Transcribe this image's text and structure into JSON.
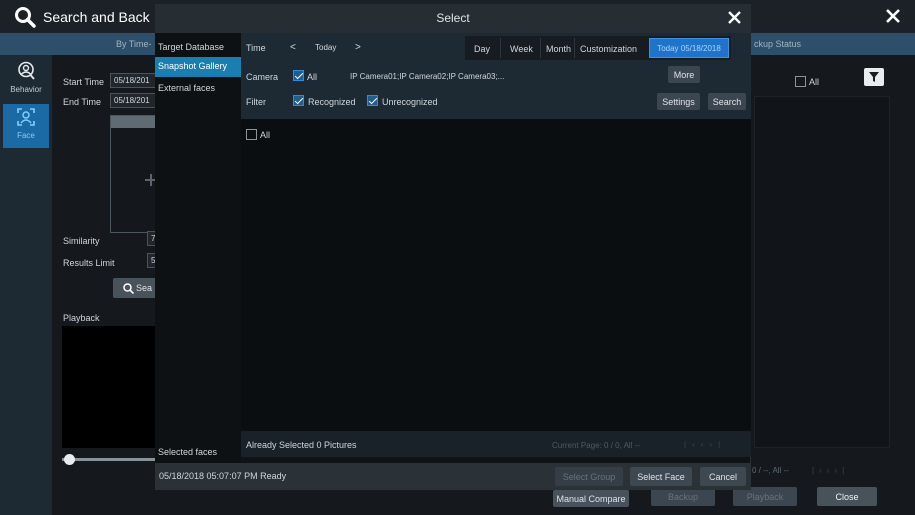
{
  "main": {
    "title": "Search and Back",
    "tab_partial": "By Time-",
    "backup_status": "ckup Status",
    "all_label": "All",
    "start_time_label": "Start Time",
    "start_time_value": "05/18/201",
    "end_time_label": "End Time",
    "end_time_value": "05/18/201",
    "similarity_label": "Similarity",
    "similarity_value": "7",
    "results_limit_label": "Results Limit",
    "results_limit_value": "5",
    "search_partial": "Sea",
    "playback_label": "Playback",
    "pager_partial": "0 / --, All --",
    "manual_compare": "Manual Compare",
    "backup": "Backup",
    "playback_btn": "Playback",
    "close": "Close"
  },
  "sidebar": {
    "behavior": "Behavior",
    "face": "Face"
  },
  "dialog": {
    "title": "Select",
    "nav": [
      "Target Database",
      "Snapshot Gallery",
      "External faces"
    ],
    "selected_faces": "Selected faces",
    "time_label": "Time",
    "today": "Today",
    "range_tabs": [
      "Day",
      "Week",
      "Month",
      "Customization"
    ],
    "date_badge": "Today 05/18/2018",
    "camera_label": "Camera",
    "camera_all": "All",
    "camera_list": "IP Camera01;IP Camera02;IP Camera03;...",
    "more": "More",
    "filter_label": "Filter",
    "recognized": "Recognized",
    "unrecognized": "Unrecognized",
    "settings": "Settings",
    "search": "Search",
    "grid_all": "All",
    "already_selected": "Already Selected 0 Pictures",
    "current_page": "Current Page: 0 / 0, All --",
    "status": "05/18/2018 05:07:07 PM Ready",
    "select_group": "Select Group",
    "select_face": "Select Face",
    "cancel": "Cancel"
  },
  "colors": {
    "accent": "#1f74c9",
    "selected_nav": "#1a7fb0",
    "face_icon": "#38a6e8"
  }
}
